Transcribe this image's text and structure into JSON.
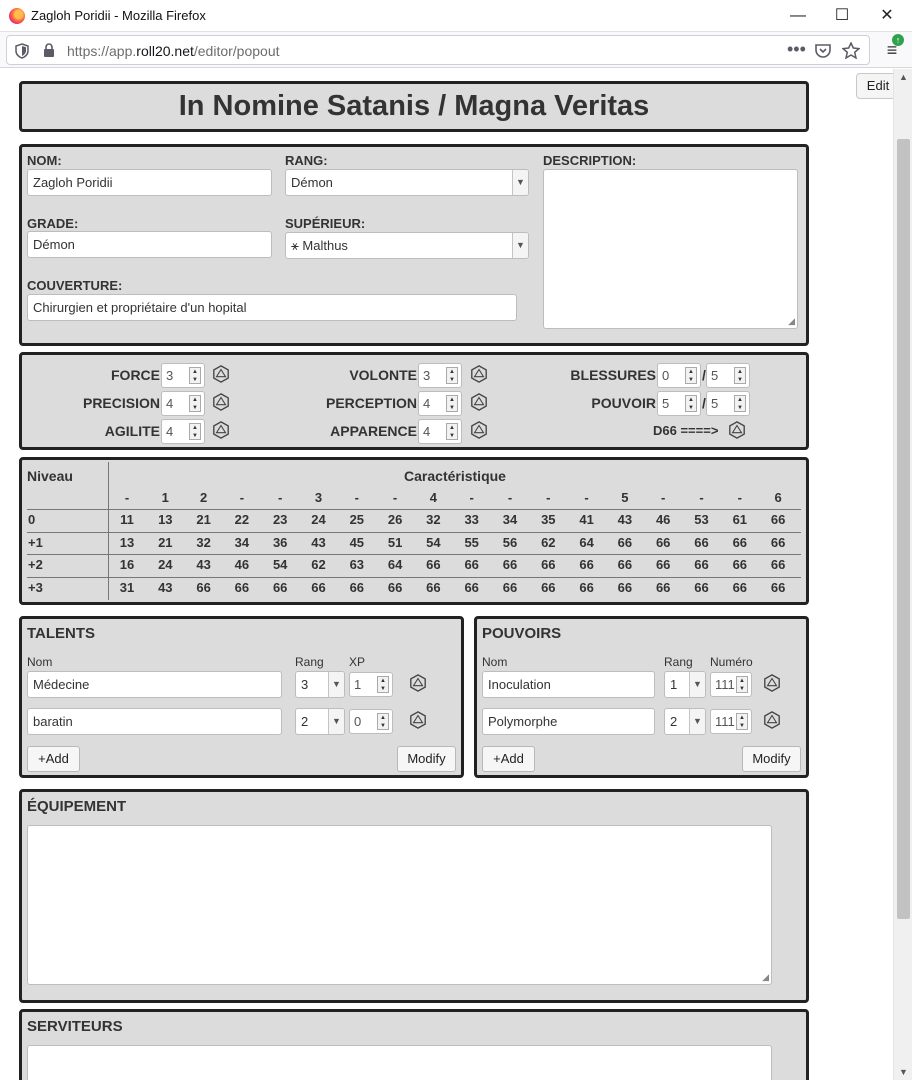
{
  "window": {
    "title": "Zagloh Poridii - Mozilla Firefox",
    "minimize": "—",
    "maximize": "☐",
    "close": "✕"
  },
  "browser": {
    "url_prefix": "https://app.",
    "url_domain": "roll20.net",
    "url_path": "/editor/popout",
    "shield_icon": "shield-icon",
    "lock_icon": "lock-icon"
  },
  "page": {
    "edit_label": "Edit"
  },
  "sheet": {
    "title": "In Nomine Satanis / Magna Veritas",
    "identity": {
      "nom_label": "NOM:",
      "nom_value": "Zagloh Poridii",
      "rang_label": "RANG:",
      "rang_value": "Démon",
      "description_label": "DESCRIPTION:",
      "grade_label": "GRADE:",
      "grade_value": "Démon",
      "superieur_label": "SUPÉRIEUR:",
      "superieur_value": "⚹ Malthus",
      "couverture_label": "COUVERTURE:",
      "couverture_value": "Chirurgien et propriétaire d'un hopital"
    },
    "stats": {
      "force_label": "FORCE",
      "force": "3",
      "precision_label": "PRECISION",
      "precision": "4",
      "agilite_label": "AGILITE",
      "agilite": "4",
      "volonte_label": "VOLONTE",
      "volonte": "3",
      "perception_label": "PERCEPTION",
      "perception": "4",
      "apparence_label": "APPARENCE",
      "apparence": "4",
      "blessures_label": "BLESSURES",
      "blessures": "0",
      "blessures_max": "5",
      "pouvoir_label": "POUVOIR",
      "pouvoir": "5",
      "pouvoir_max": "5",
      "slash": "/",
      "d66_label": "D66 ====>"
    },
    "table": {
      "niveau_label": "Niveau",
      "carac_label": "Caractéristique",
      "headers": [
        "-",
        "1",
        "2",
        "-",
        "-",
        "3",
        "-",
        "-",
        "4",
        "-",
        "-",
        "-",
        "-",
        "5",
        "-",
        "-",
        "-",
        "6"
      ],
      "rows": [
        {
          "label": "0",
          "values": [
            "11",
            "13",
            "21",
            "22",
            "23",
            "24",
            "25",
            "26",
            "32",
            "33",
            "34",
            "35",
            "41",
            "43",
            "46",
            "53",
            "61",
            "66"
          ]
        },
        {
          "label": "+1",
          "values": [
            "13",
            "21",
            "32",
            "34",
            "36",
            "43",
            "45",
            "51",
            "54",
            "55",
            "56",
            "62",
            "64",
            "66",
            "66",
            "66",
            "66",
            "66"
          ]
        },
        {
          "label": "+2",
          "values": [
            "16",
            "24",
            "43",
            "46",
            "54",
            "62",
            "63",
            "64",
            "66",
            "66",
            "66",
            "66",
            "66",
            "66",
            "66",
            "66",
            "66",
            "66"
          ]
        },
        {
          "label": "+3",
          "values": [
            "31",
            "43",
            "66",
            "66",
            "66",
            "66",
            "66",
            "66",
            "66",
            "66",
            "66",
            "66",
            "66",
            "66",
            "66",
            "66",
            "66",
            "66"
          ]
        }
      ]
    },
    "talents": {
      "title": "TALENTS",
      "col_nom": "Nom",
      "col_rang": "Rang",
      "col_xp": "XP",
      "items": [
        {
          "nom": "Médecine",
          "rang": "3",
          "xp": "1"
        },
        {
          "nom": "baratin",
          "rang": "2",
          "xp": "0"
        }
      ],
      "add_label": "+Add",
      "modify_label": "Modify"
    },
    "pouvoirs": {
      "title": "POUVOIRS",
      "col_nom": "Nom",
      "col_rang": "Rang",
      "col_numero": "Numéro",
      "items": [
        {
          "nom": "Inoculation",
          "rang": "1",
          "numero": "111"
        },
        {
          "nom": "Polymorphe",
          "rang": "2",
          "numero": "111"
        }
      ],
      "add_label": "+Add",
      "modify_label": "Modify"
    },
    "equipement": {
      "title": "ÉQUIPEMENT"
    },
    "serviteurs": {
      "title": "SERVITEURS"
    }
  }
}
